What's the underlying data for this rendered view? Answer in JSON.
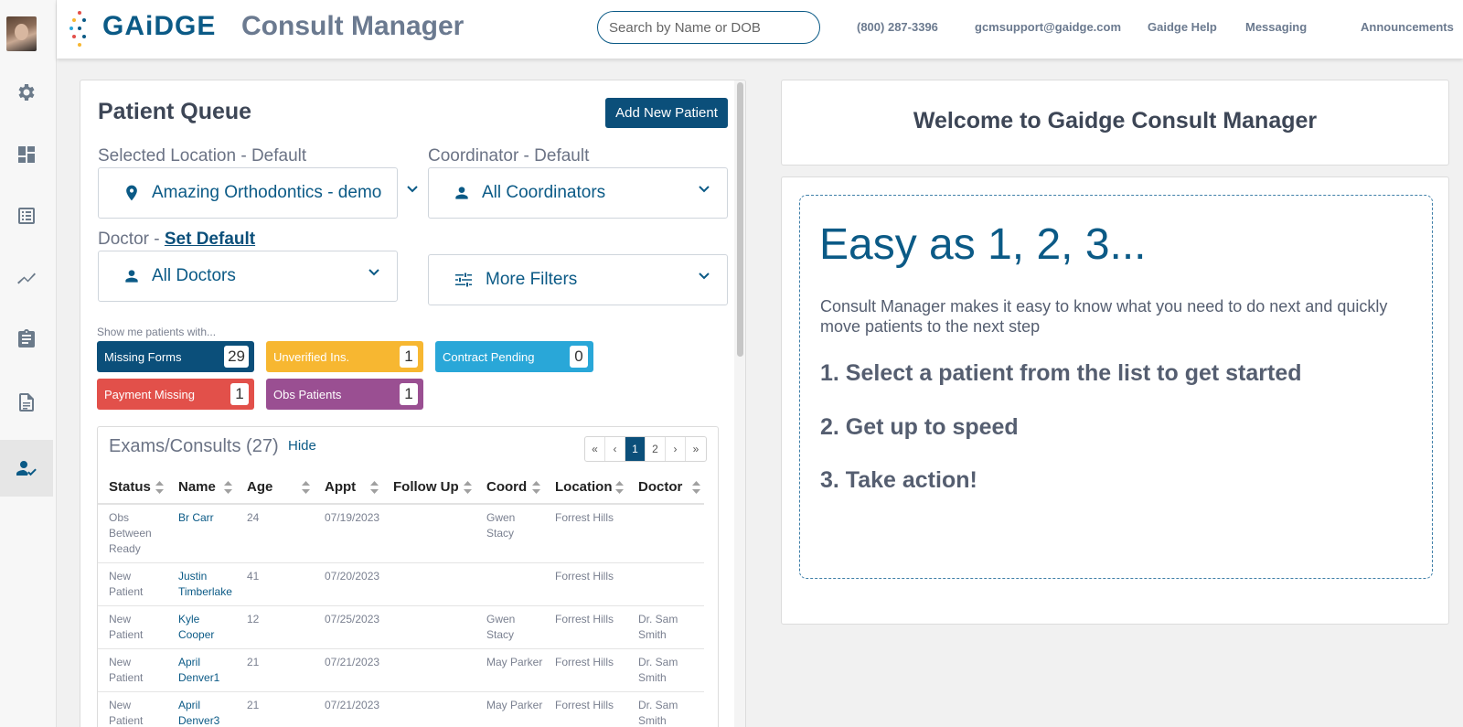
{
  "header": {
    "brand": "GAiDGE",
    "app_name": "Consult Manager",
    "search_placeholder": "Search by Name or DOB",
    "phone": "(800) 287-3396",
    "email": "gcmsupport@gaidge.com",
    "help": "Gaidge Help",
    "messaging": "Messaging",
    "announcements": "Announcements"
  },
  "sidebar": {
    "icons": [
      "settings-icon",
      "dashboard-icon",
      "list-icon",
      "analytics-icon",
      "clipboard-icon",
      "document-icon",
      "patients-icon"
    ],
    "active": "patients-icon"
  },
  "queue": {
    "title": "Patient Queue",
    "add_button": "Add New Patient",
    "location_label": "Selected Location - Default",
    "location_value": "Amazing Orthodontics - demo",
    "coordinator_label": "Coordinator - Default",
    "coordinator_value": "All Coordinators",
    "doctor_label": "Doctor - ",
    "doctor_set_default": "Set Default",
    "doctor_value": "All Doctors",
    "more_filters": "More Filters",
    "hint": "Show me patients with...",
    "chips": [
      {
        "label": "Missing Forms",
        "count": "29",
        "color": "#0b4f7a"
      },
      {
        "label": "Unverified Ins.",
        "count": "1",
        "color": "#f7b731"
      },
      {
        "label": "Contract Pending",
        "count": "0",
        "color": "#29a7d8"
      },
      {
        "label": "Payment Missing",
        "count": "1",
        "color": "#e2504a"
      },
      {
        "label": "Obs Patients",
        "count": "1",
        "color": "#9a4f92"
      }
    ]
  },
  "exams": {
    "title": "Exams/Consults (27)",
    "hide": "Hide",
    "pager": [
      "«",
      "‹",
      "1",
      "2",
      "›",
      "»"
    ],
    "columns": [
      "Status",
      "Name",
      "Age",
      "Appt",
      "Follow Up",
      "Coord",
      "Location",
      "Doctor"
    ],
    "rows": [
      {
        "status": "Obs Between Ready",
        "name": "Br Carr",
        "age": "24",
        "appt": "07/19/2023",
        "follow": "",
        "coord": "Gwen Stacy",
        "location": "Forrest Hills",
        "doctor": ""
      },
      {
        "status": "New Patient",
        "name": "Justin Timberlake",
        "age": "41",
        "appt": "07/20/2023",
        "follow": "",
        "coord": "",
        "location": "Forrest Hills",
        "doctor": ""
      },
      {
        "status": "New Patient",
        "name": "Kyle Cooper",
        "age": "12",
        "appt": "07/25/2023",
        "follow": "",
        "coord": "Gwen Stacy",
        "location": "Forrest Hills",
        "doctor": "Dr. Sam Smith"
      },
      {
        "status": "New Patient",
        "name": "April Denver1",
        "age": "21",
        "appt": "07/21/2023",
        "follow": "",
        "coord": "May Parker",
        "location": "Forrest Hills",
        "doctor": "Dr. Sam Smith"
      },
      {
        "status": "New Patient",
        "name": "April Denver3",
        "age": "21",
        "appt": "07/21/2023",
        "follow": "",
        "coord": "May Parker",
        "location": "Forrest Hills",
        "doctor": "Dr. Sam Smith"
      }
    ]
  },
  "welcome": {
    "title": "Welcome to Gaidge Consult Manager",
    "headline": "Easy as 1, 2, 3...",
    "intro": "Consult Manager makes it easy to know what you need to do next and quickly move patients to the next step",
    "steps": [
      "1. Select a patient from the list to get started",
      "2. Get up to speed",
      "3. Take action!"
    ]
  }
}
